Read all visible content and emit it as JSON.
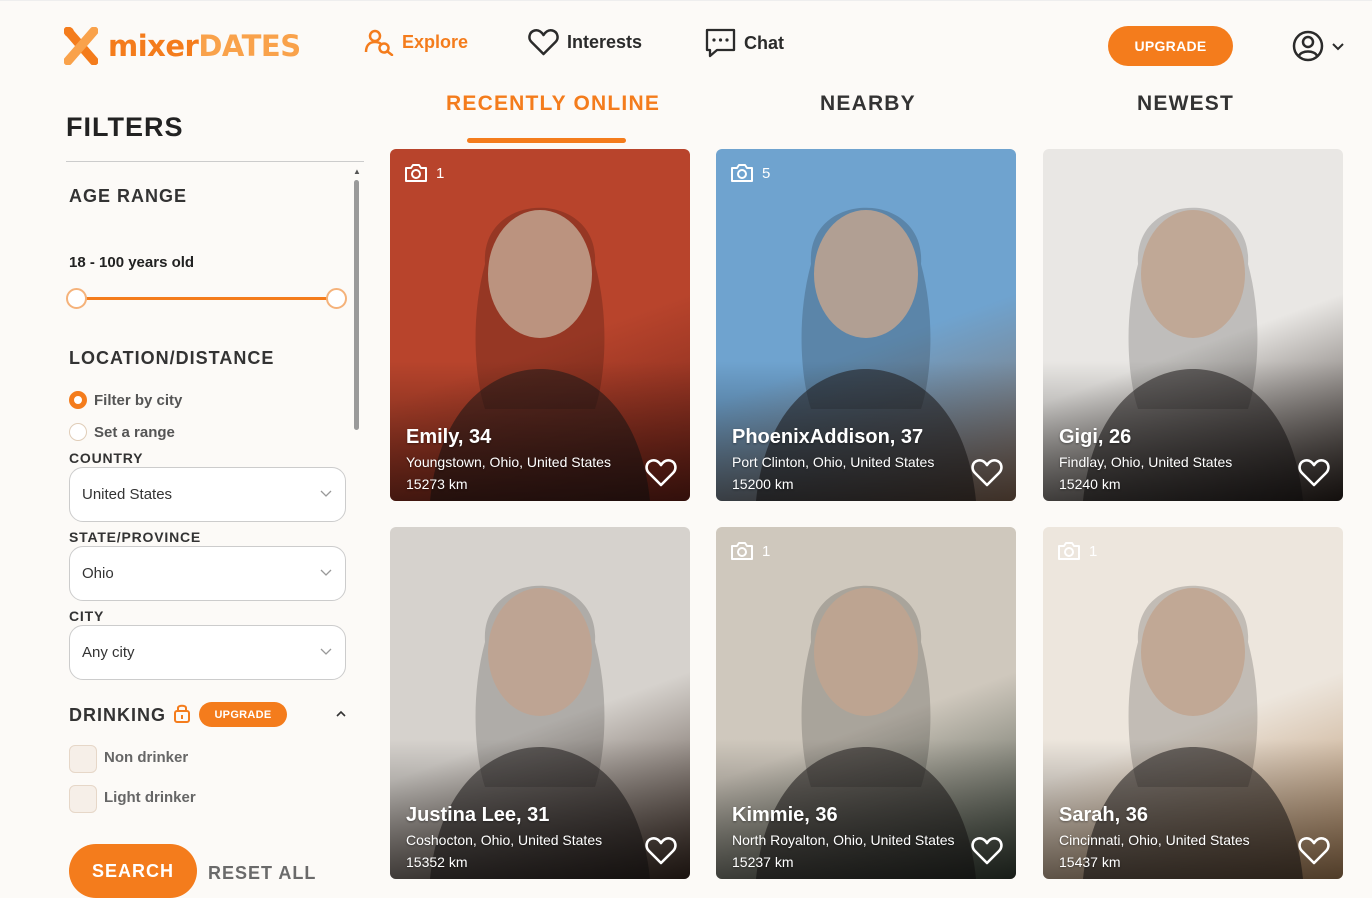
{
  "brand": {
    "name_part1": "mixer",
    "name_part2": "DATES",
    "accent": "#f47c1c"
  },
  "nav": {
    "explore": "Explore",
    "interests": "Interests",
    "chat": "Chat",
    "upgrade": "UPGRADE"
  },
  "filters": {
    "title": "FILTERS",
    "age_range_title": "AGE RANGE",
    "age_range_value": "18 - 100 years old",
    "age_min": 18,
    "age_max": 100,
    "location_title": "LOCATION/DISTANCE",
    "radio_city": "Filter by city",
    "radio_range": "Set a range",
    "country_label": "COUNTRY",
    "country_value": "United States",
    "state_label": "STATE/PROVINCE",
    "state_value": "Ohio",
    "city_label": "CITY",
    "city_value": "Any city",
    "drinking_title": "DRINKING",
    "drinking_upgrade": "UPGRADE",
    "drinking_options": [
      "Non drinker",
      "Light drinker"
    ],
    "search": "SEARCH",
    "reset": "RESET ALL"
  },
  "tabs": [
    "RECENTLY ONLINE",
    "NEARBY",
    "NEWEST"
  ],
  "profiles": [
    {
      "name": "Emily, 34",
      "location": "Youngstown, Ohio, United States",
      "distance": "15273 km",
      "photos": "1",
      "bg": "#b8442c",
      "bg2": "#6e2218"
    },
    {
      "name": "PhoenixAddison, 37",
      "location": "Port Clinton, Ohio, United States",
      "distance": "15200 km",
      "photos": "5",
      "bg": "#6fa3cf",
      "bg2": "#8a6a55"
    },
    {
      "name": "Gigi, 26",
      "location": "Findlay, Ohio, United States",
      "distance": "15240 km",
      "photos": "",
      "bg": "#e9e7e4",
      "bg2": "#2a211d"
    },
    {
      "name": "Justina Lee, 31",
      "location": "Coshocton, Ohio, United States",
      "distance": "15352 km",
      "photos": "",
      "bg": "#d6d2cd",
      "bg2": "#3a2a22"
    },
    {
      "name": "Kimmie, 36",
      "location": "North Royalton, Ohio, United States",
      "distance": "15237 km",
      "photos": "1",
      "bg": "#cfc8bd",
      "bg2": "#354035"
    },
    {
      "name": "Sarah, 36",
      "location": "Cincinnati, Ohio, United States",
      "distance": "15437 km",
      "photos": "1",
      "bg": "#ede6dd",
      "bg2": "#b0855a"
    }
  ]
}
